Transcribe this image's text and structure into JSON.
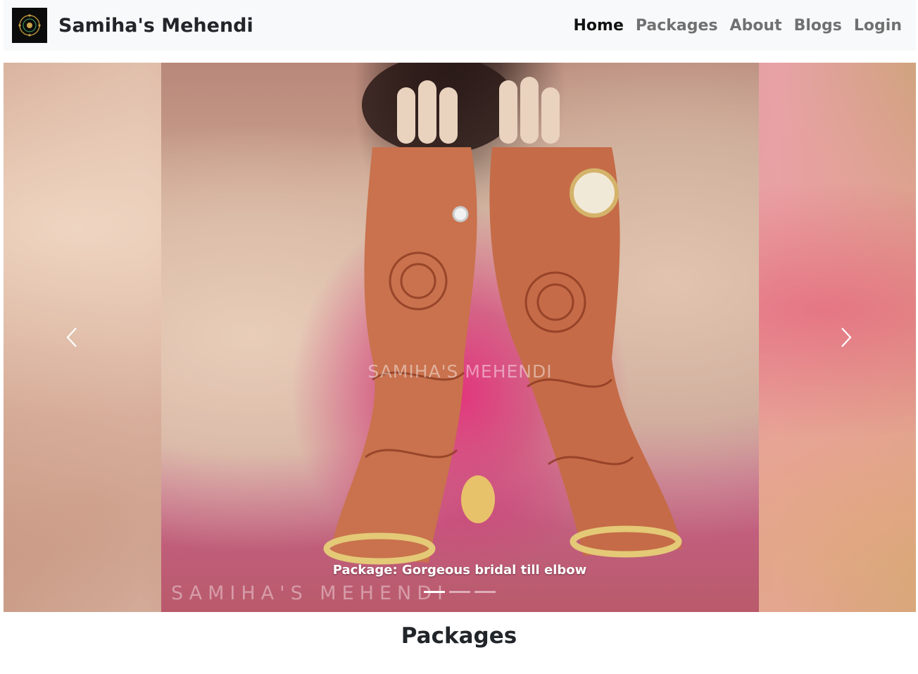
{
  "navbar": {
    "brand": "Samiha's Mehendi",
    "links": [
      {
        "label": "Home",
        "active": true
      },
      {
        "label": "Packages",
        "active": false
      },
      {
        "label": "About",
        "active": false
      },
      {
        "label": "Blogs",
        "active": false
      },
      {
        "label": "Login",
        "active": false
      }
    ]
  },
  "carousel": {
    "caption": "Package: Gorgeous bridal till elbow",
    "watermark_center": "SAMIHA'S MEHENDI",
    "watermark_bottom": "SAMIHA'S MEHENDI",
    "slide_count": 3,
    "active_index": 0,
    "prev_icon": "chevron-left-icon",
    "next_icon": "chevron-right-icon"
  },
  "main": {
    "section_title": "Packages"
  },
  "colors": {
    "navbar_bg": "#f8f9fa",
    "brand_text": "#212529",
    "nav_inactive": "rgba(0,0,0,0.55)",
    "caption_text": "#ffffff"
  }
}
